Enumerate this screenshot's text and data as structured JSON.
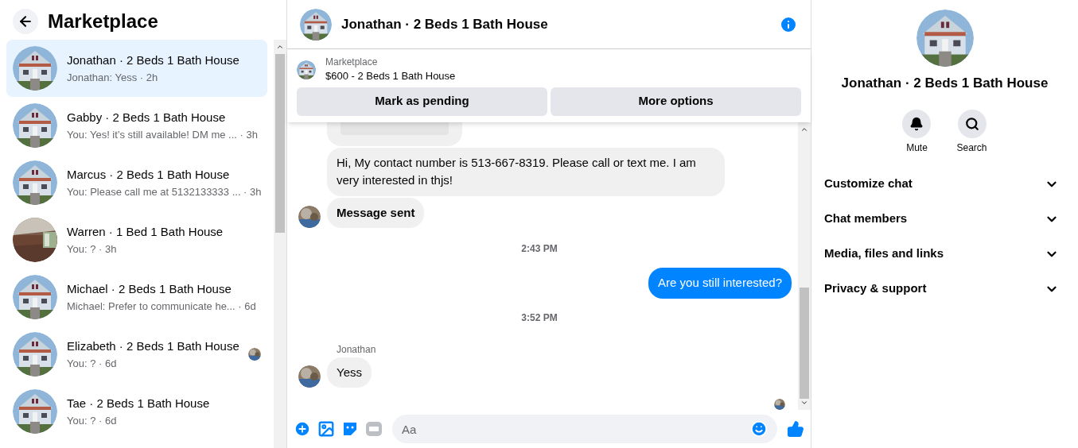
{
  "sidebar": {
    "title": "Marketplace",
    "conversations": [
      {
        "name": "Jonathan · 2 Beds 1 Bath House",
        "preview": "Jonathan: Yess · 2h",
        "selected": true,
        "kind": "house",
        "seen": false
      },
      {
        "name": "Gabby · 2 Beds 1 Bath House",
        "preview": "You: Yes! it’s still available! DM me ... · 3h",
        "selected": false,
        "kind": "house",
        "seen": false
      },
      {
        "name": "Marcus · 2 Beds 1 Bath House",
        "preview": "You: Please call me at 5132133333 ... · 3h",
        "selected": false,
        "kind": "house",
        "seen": false
      },
      {
        "name": "Warren · 1 Bed 1 Bath House",
        "preview": "You: ? · 3h",
        "selected": false,
        "kind": "room",
        "seen": false
      },
      {
        "name": "Michael · 2 Beds 1 Bath House",
        "preview": "Michael: Prefer to communicate he... · 6d",
        "selected": false,
        "kind": "house",
        "seen": false
      },
      {
        "name": "Elizabeth · 2 Beds 1 Bath House",
        "preview": "You: ? · 6d",
        "selected": false,
        "kind": "house",
        "seen": true
      },
      {
        "name": "Tae · 2 Beds 1 Bath House",
        "preview": "You: ? · 6d",
        "selected": false,
        "kind": "house",
        "seen": false
      }
    ]
  },
  "chat": {
    "title": "Jonathan · 2 Beds 1 Bath House",
    "listing": {
      "source": "Marketplace",
      "title": "$600 - 2 Beds 1 Bath House",
      "buttons": [
        "Mark as pending",
        "More options"
      ]
    },
    "messages": [
      {
        "kind": "incoming",
        "text": "Hi, My contact number is 513-667-8319. Please call or text me. I am very interested in thjs!",
        "avatar": false,
        "bold": false
      },
      {
        "kind": "incoming",
        "text": "Message sent",
        "avatar": true,
        "bold": true
      },
      {
        "kind": "time",
        "text": "2:43 PM"
      },
      {
        "kind": "outgoing",
        "text": "Are you still interested?"
      },
      {
        "kind": "time",
        "text": "3:52 PM"
      },
      {
        "kind": "sender",
        "text": "Jonathan"
      },
      {
        "kind": "incoming",
        "text": "Yess",
        "avatar": true,
        "bold": false
      }
    ],
    "composer": {
      "placeholder": "Aa"
    }
  },
  "details": {
    "title": "Jonathan · 2 Beds 1 Bath House",
    "actions": [
      {
        "kind": "mute",
        "label": "Mute"
      },
      {
        "kind": "search",
        "label": "Search"
      }
    ],
    "sections": [
      {
        "label": "Customize chat",
        "expanded": false
      },
      {
        "label": "Chat members",
        "expanded": false
      },
      {
        "label": "Media, files and links",
        "expanded": false
      },
      {
        "label": "Privacy & support",
        "expanded": false
      }
    ]
  }
}
